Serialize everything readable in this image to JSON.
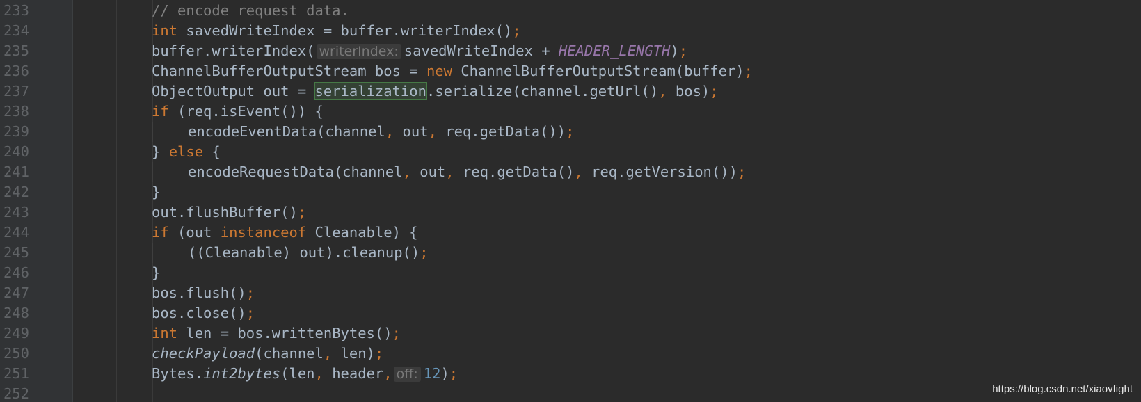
{
  "editor": {
    "lines": [
      {
        "n": "233",
        "code": "// encode request data."
      },
      {
        "n": "234",
        "code": "int savedWriteIndex = buffer.writerIndex();"
      },
      {
        "n": "235",
        "code": "buffer.writerIndex( writerIndex: savedWriteIndex + HEADER_LENGTH);"
      },
      {
        "n": "236",
        "code": "ChannelBufferOutputStream bos = new ChannelBufferOutputStream(buffer);"
      },
      {
        "n": "237",
        "code": "ObjectOutput out = serialization.serialize(channel.getUrl(), bos);"
      },
      {
        "n": "238",
        "code": "if (req.isEvent()) {"
      },
      {
        "n": "239",
        "code": "encodeEventData(channel, out, req.getData());"
      },
      {
        "n": "240",
        "code": "} else {"
      },
      {
        "n": "241",
        "code": "encodeRequestData(channel, out, req.getData(), req.getVersion());"
      },
      {
        "n": "242",
        "code": "}"
      },
      {
        "n": "243",
        "code": "out.flushBuffer();"
      },
      {
        "n": "244",
        "code": "if (out instanceof Cleanable) {"
      },
      {
        "n": "245",
        "code": "((Cleanable) out).cleanup();"
      },
      {
        "n": "246",
        "code": "}"
      },
      {
        "n": "247",
        "code": "bos.flush();"
      },
      {
        "n": "248",
        "code": "bos.close();"
      },
      {
        "n": "249",
        "code": "int len = bos.writtenBytes();"
      },
      {
        "n": "250",
        "code": "checkPayload(channel, len);"
      },
      {
        "n": "251",
        "code": "Bytes.int2bytes(len, header,  off: 12);"
      },
      {
        "n": "252",
        "code": ""
      }
    ],
    "hints": {
      "writer_index": "writerIndex:",
      "off": "off:"
    },
    "highlighted_symbol": "serialization"
  },
  "watermark": "https://blog.csdn.net/xiaovfight",
  "colors": {
    "background": "#2b2b2b",
    "gutter": "#313335",
    "line_number": "#606366",
    "text": "#a9b7c6",
    "keyword": "#cc7832",
    "comment": "#808080",
    "constant": "#9876aa",
    "number": "#6897bb",
    "highlight": "#344134"
  }
}
